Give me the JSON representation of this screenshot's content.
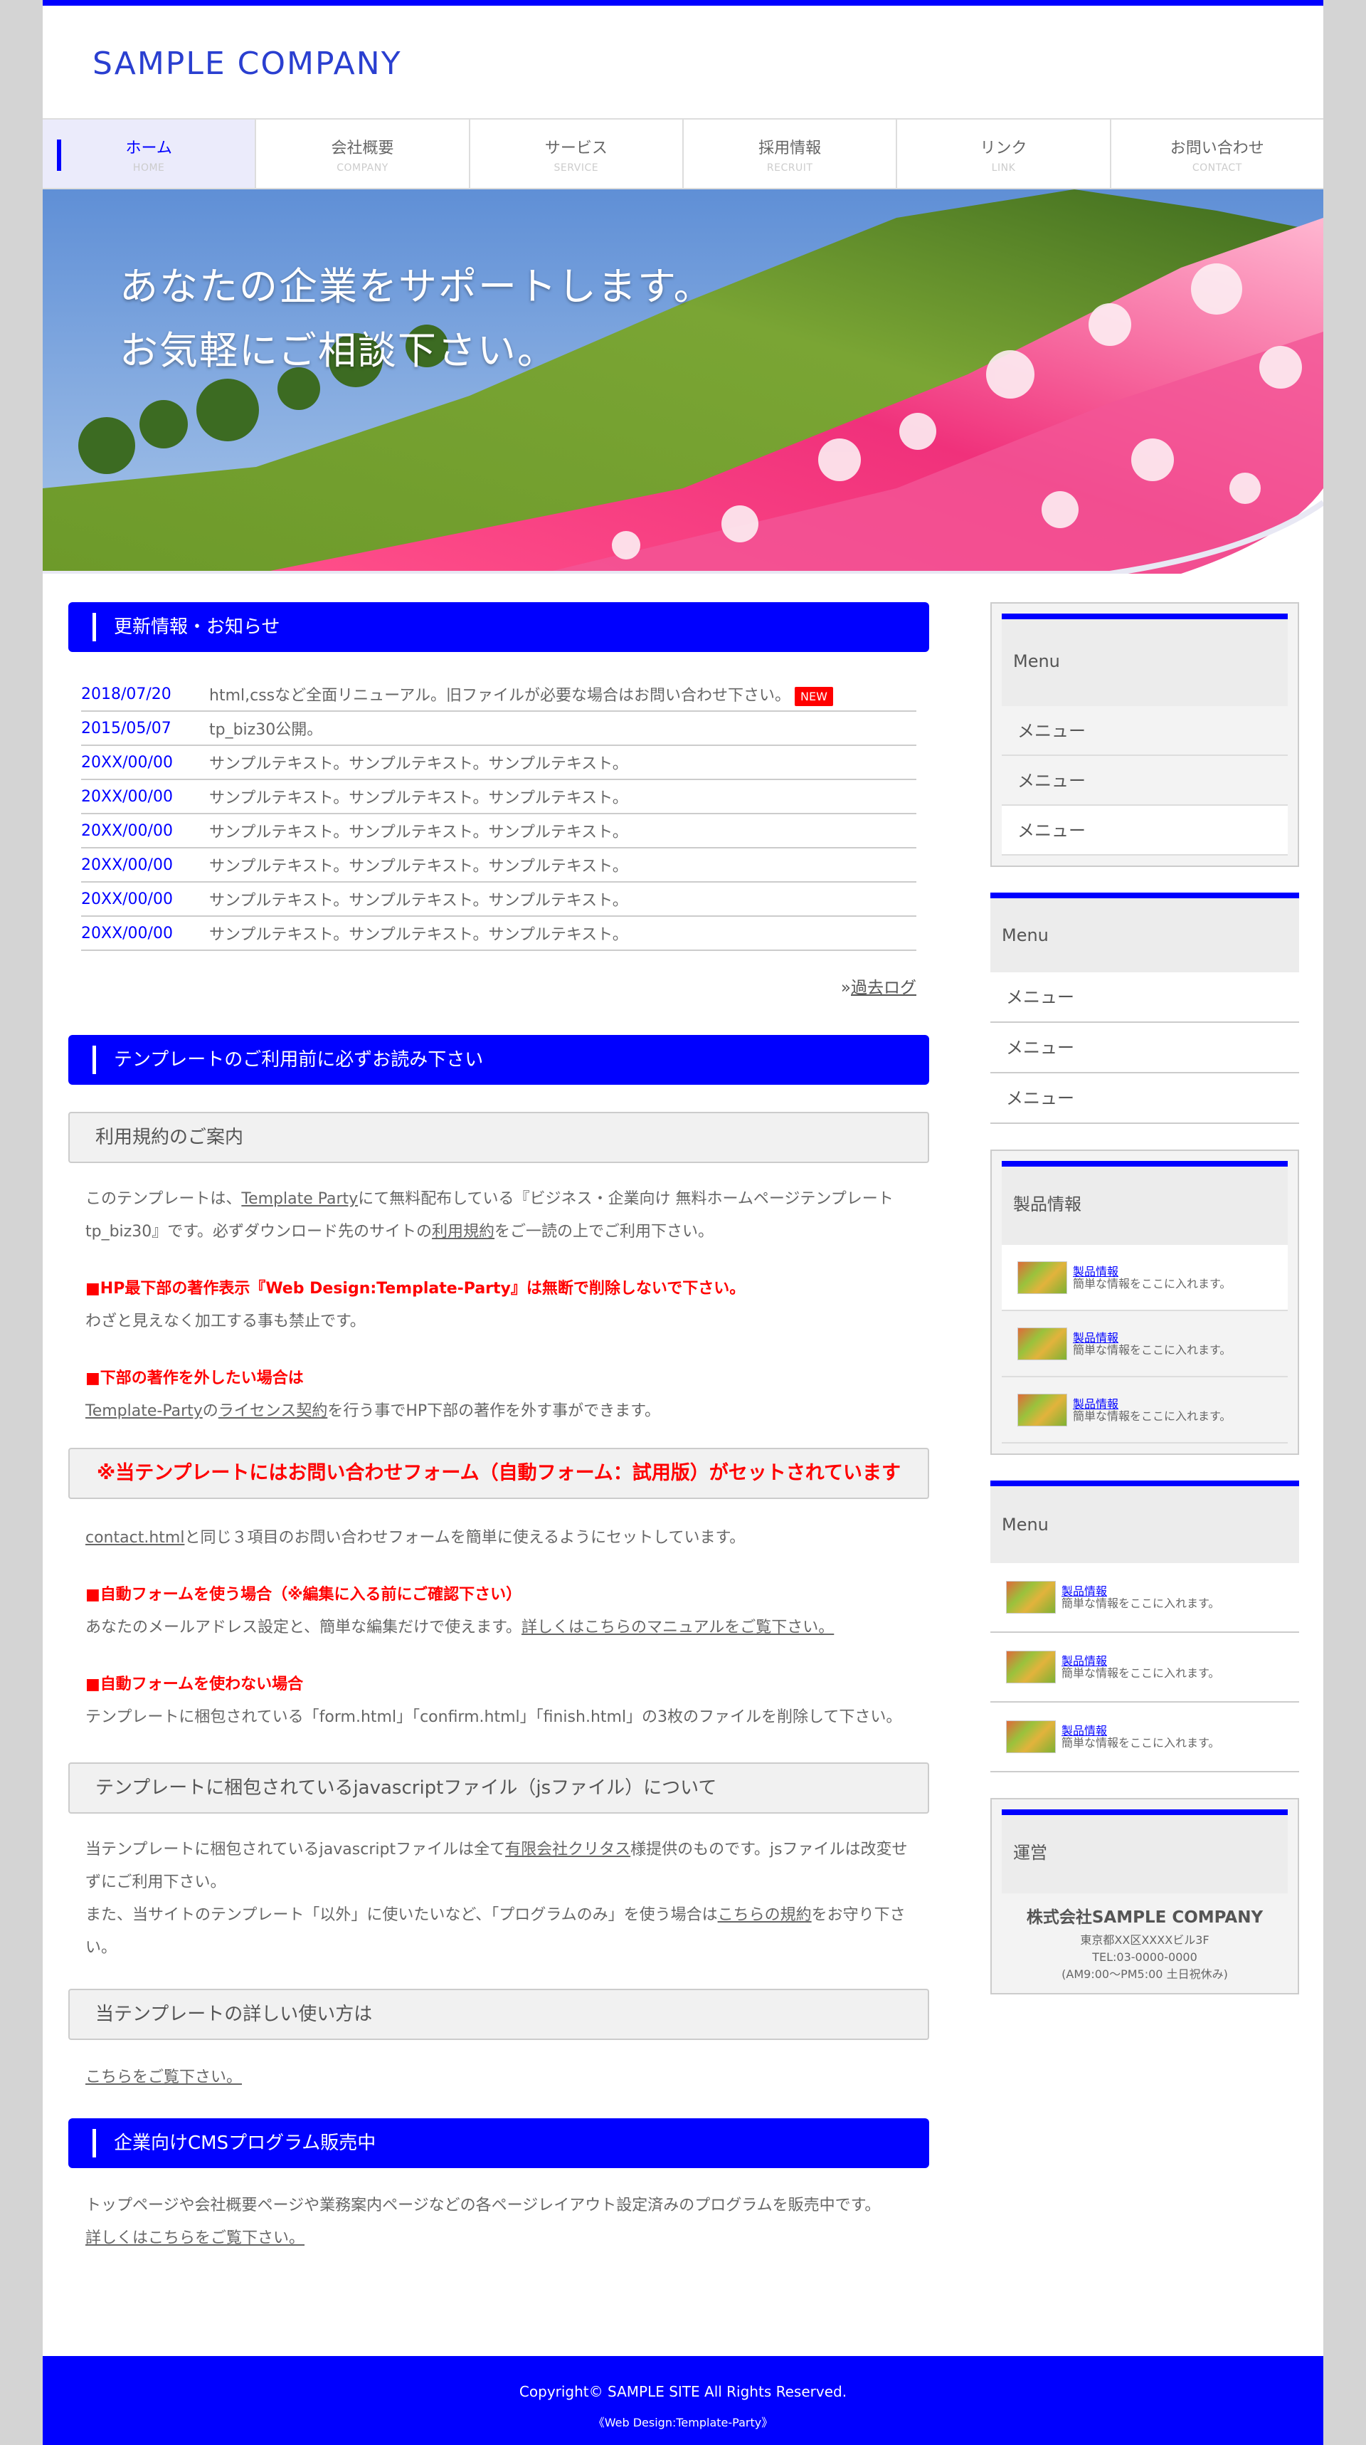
{
  "header": {
    "logo": "SAMPLE COMPANY"
  },
  "nav": [
    {
      "label": "ホーム",
      "sub": "HOME"
    },
    {
      "label": "会社概要",
      "sub": "COMPANY"
    },
    {
      "label": "サービス",
      "sub": "SERVICE"
    },
    {
      "label": "採用情報",
      "sub": "RECRUIT"
    },
    {
      "label": "リンク",
      "sub": "LINK"
    },
    {
      "label": "お問い合わせ",
      "sub": "CONTACT"
    }
  ],
  "hero": {
    "line1": "あなたの企業をサポートします。",
    "line2": "お気軽にご相談下さい。"
  },
  "news": {
    "title": "更新情報・お知らせ",
    "items": [
      {
        "date": "2018/07/20",
        "text": "html,cssなど全面リニューアル。旧ファイルが必要な場合はお問い合わせ下さい。",
        "badge": "NEW"
      },
      {
        "date": "2015/05/07",
        "text": "tp_biz30公開。"
      },
      {
        "date": "20XX/00/00",
        "text": "サンプルテキスト。サンプルテキスト。サンプルテキスト。"
      },
      {
        "date": "20XX/00/00",
        "text": "サンプルテキスト。サンプルテキスト。サンプルテキスト。"
      },
      {
        "date": "20XX/00/00",
        "text": "サンプルテキスト。サンプルテキスト。サンプルテキスト。"
      },
      {
        "date": "20XX/00/00",
        "text": "サンプルテキスト。サンプルテキスト。サンプルテキスト。"
      },
      {
        "date": "20XX/00/00",
        "text": "サンプルテキスト。サンプルテキスト。サンプルテキスト。"
      },
      {
        "date": "20XX/00/00",
        "text": "サンプルテキスト。サンプルテキスト。サンプルテキスト。"
      }
    ],
    "past_prefix": "»",
    "past_link": "過去ログ"
  },
  "tpl": {
    "title": "テンプレートのご利用前に必ずお読み下さい",
    "terms_title": "利用規約のご案内",
    "p1a": "このテンプレートは、",
    "p1_link1": "Template Party",
    "p1b": "にて無料配布している『ビジネス・企業向け 無料ホームページテンプレート tp_biz30』です。必ずダウンロード先のサイトの",
    "p1_link2": "利用規約",
    "p1c": "をご一読の上でご利用下さい。",
    "red1": "■HP最下部の著作表示『Web Design:Template-Party』は無断で削除しないで下さい。",
    "p2": "わざと見えなく加工する事も禁止です。",
    "red2": "■下部の著作を外したい場合は",
    "p3_link1": "Template-Party",
    "p3a": "の",
    "p3_link2": "ライセンス契約",
    "p3b": "を行う事でHP下部の著作を外す事ができます。",
    "form_title": "※当テンプレートにはお問い合わせフォーム（自動フォーム：試用版）がセットされています",
    "p4_link": "contact.html",
    "p4": "と同じ３項目のお問い合わせフォームを簡単に使えるようにセットしています。",
    "red3": "■自動フォームを使う場合（※編集に入る前にご確認下さい）",
    "p5": "あなたのメールアドレス設定と、簡単な編集だけで使えます。",
    "p5_link": "詳しくはこちらのマニュアルをご覧下さい。",
    "red4": "■自動フォームを使わない場合",
    "p6": "テンプレートに梱包されている「form.html」「confirm.html」「finish.html」の3枚のファイルを削除して下さい。",
    "js_title": "テンプレートに梱包されているjavascriptファイル（jsファイル）について",
    "p7a": "当テンプレートに梱包されているjavascriptファイルは全て",
    "p7_link": "有限会社クリタス",
    "p7b": "様提供のものです。jsファイルは改変せずにご利用下さい。",
    "p8a": "また、当サイトのテンプレート「以外」に使いたいなど、「プログラムのみ」を使う場合は",
    "p8_link": "こちらの規約",
    "p8b": "をお守り下さい。",
    "howto_title": "当テンプレートの詳しい使い方は",
    "howto_link": "こちらをご覧下さい。"
  },
  "cms": {
    "title": "企業向けCMSプログラム販売中",
    "p": "トップページや会社概要ページや業務案内ページなどの各ページレイアウト設定済みのプログラムを販売中です。",
    "link": "詳しくはこちらをご覧下さい。"
  },
  "sidebar": {
    "menu1": {
      "title": "Menu",
      "items": [
        "メニュー",
        "メニュー",
        "メニュー"
      ]
    },
    "menu2": {
      "title": "Menu",
      "items": [
        "メニュー",
        "メニュー",
        "メニュー"
      ]
    },
    "products1": {
      "title": "製品情報",
      "items": [
        {
          "name": "製品情報",
          "desc": "簡単な情報をここに入れます。"
        },
        {
          "name": "製品情報",
          "desc": "簡単な情報をここに入れます。"
        },
        {
          "name": "製品情報",
          "desc": "簡単な情報をここに入れます。"
        }
      ]
    },
    "products2": {
      "title": "Menu",
      "items": [
        {
          "name": "製品情報",
          "desc": "簡単な情報をここに入れます。"
        },
        {
          "name": "製品情報",
          "desc": "簡単な情報をここに入れます。"
        },
        {
          "name": "製品情報",
          "desc": "簡単な情報をここに入れます。"
        }
      ]
    },
    "unei": {
      "title": "運営",
      "name": "株式会社SAMPLE COMPANY",
      "address": "東京都XX区XXXXビル3F",
      "tel": "TEL:03-0000-0000",
      "hours": "(AM9:00〜PM5:00 土日祝休み)"
    }
  },
  "footer": {
    "copyright": "Copyright© SAMPLE SITE All Rights Reserved.",
    "credit": "《Web Design:Template-Party》"
  },
  "colors": {
    "accent": "#0000ff",
    "new_badge": "#ff0000",
    "page_bg": "#d4d4d4"
  }
}
